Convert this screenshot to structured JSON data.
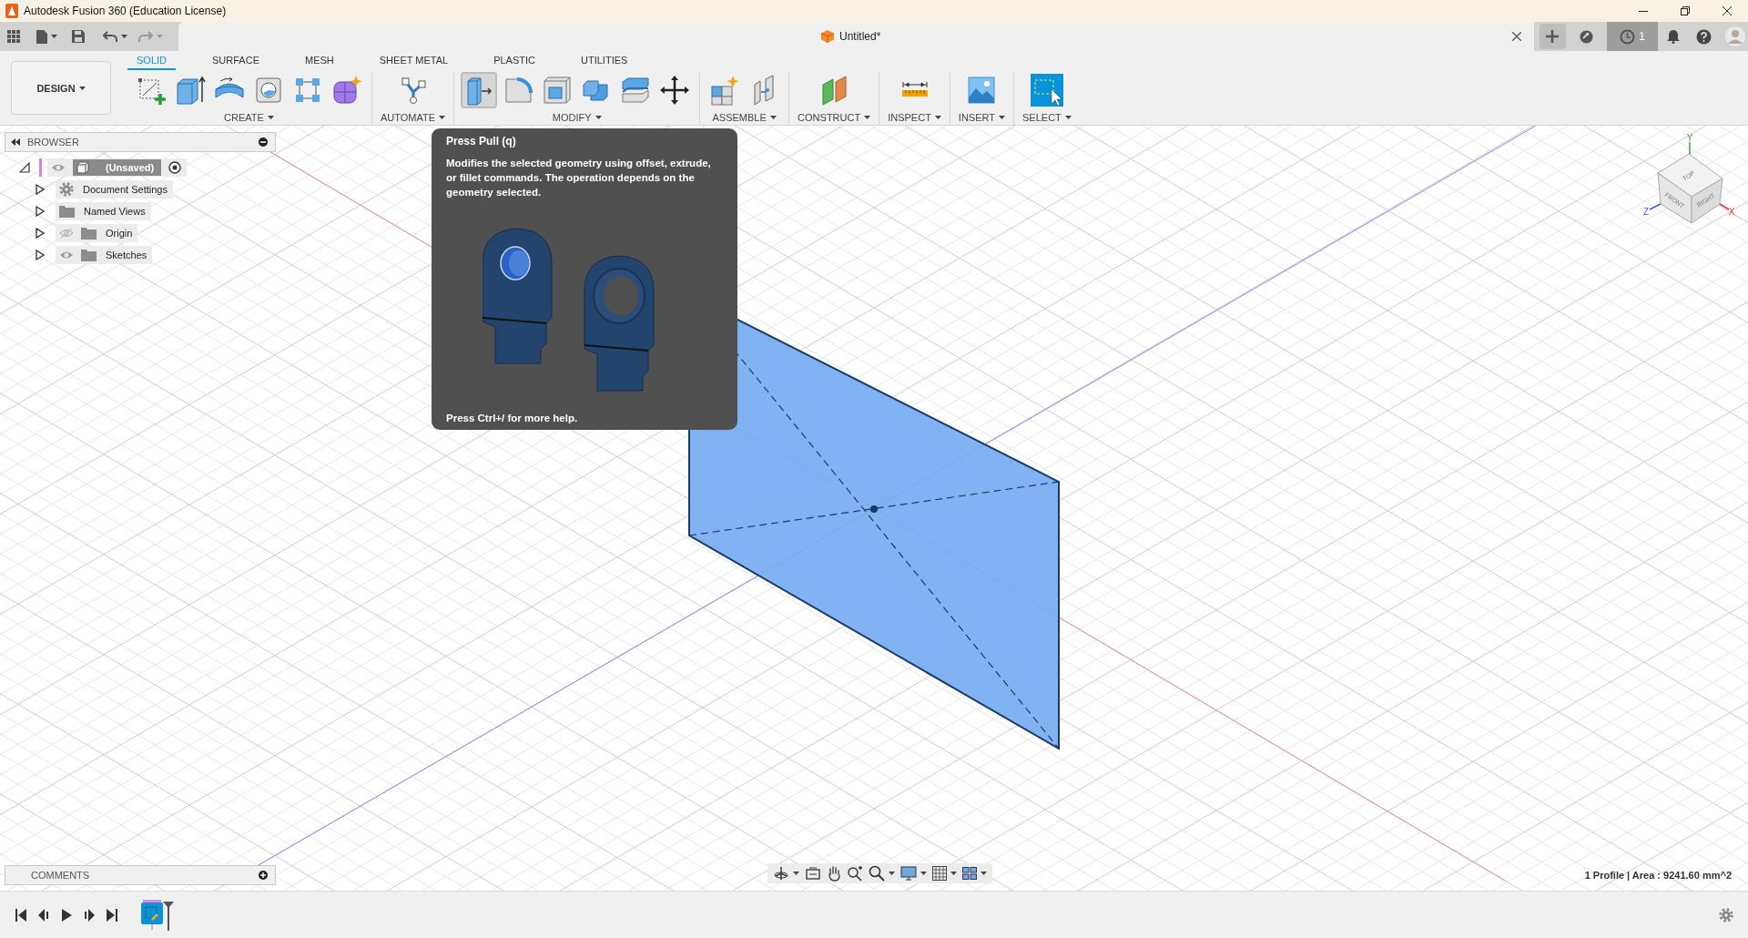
{
  "window": {
    "title": "Autodesk Fusion 360 (Education License)"
  },
  "document_tab": {
    "title": "Untitled*",
    "job_count": "1"
  },
  "workspace": {
    "label": "DESIGN"
  },
  "ribbon_tabs": [
    {
      "label": "SOLID",
      "selected": true
    },
    {
      "label": "SURFACE",
      "selected": false
    },
    {
      "label": "MESH",
      "selected": false
    },
    {
      "label": "SHEET METAL",
      "selected": false
    },
    {
      "label": "PLASTIC",
      "selected": false
    },
    {
      "label": "UTILITIES",
      "selected": false
    }
  ],
  "ribbon_groups": [
    {
      "label": "CREATE",
      "tools": [
        {
          "kind": "sketch",
          "hovered": false
        },
        {
          "kind": "extrude",
          "hovered": false
        },
        {
          "kind": "revolve",
          "hovered": false
        },
        {
          "kind": "hole",
          "hovered": false
        },
        {
          "kind": "pattern",
          "hovered": false
        },
        {
          "kind": "form",
          "hovered": false
        }
      ]
    },
    {
      "label": "AUTOMATE",
      "tools": [
        {
          "kind": "automate",
          "hovered": false
        }
      ]
    },
    {
      "label": "MODIFY",
      "tools": [
        {
          "kind": "press_pull",
          "hovered": true
        },
        {
          "kind": "fillet",
          "hovered": false
        },
        {
          "kind": "shell",
          "hovered": false
        },
        {
          "kind": "combine",
          "hovered": false
        },
        {
          "kind": "offset_face",
          "hovered": false
        },
        {
          "kind": "move",
          "hovered": false
        }
      ]
    },
    {
      "label": "ASSEMBLE",
      "tools": [
        {
          "kind": "new_component",
          "hovered": false
        },
        {
          "kind": "joint",
          "hovered": false
        }
      ]
    },
    {
      "label": "CONSTRUCT",
      "tools": [
        {
          "kind": "plane",
          "hovered": false
        }
      ]
    },
    {
      "label": "INSPECT",
      "tools": [
        {
          "kind": "measure",
          "hovered": false
        }
      ]
    },
    {
      "label": "INSERT",
      "tools": [
        {
          "kind": "insert_image",
          "hovered": false
        }
      ]
    },
    {
      "label": "SELECT",
      "tools": [
        {
          "kind": "select",
          "hovered": false
        }
      ]
    }
  ],
  "browser": {
    "title": "BROWSER",
    "tree": {
      "label": "(Unsaved)",
      "kind": "component",
      "visible": true,
      "expanded": true,
      "children": [
        {
          "label": "Document Settings",
          "kind": "settings",
          "expanded": false
        },
        {
          "label": "Named Views",
          "kind": "views",
          "expanded": false
        },
        {
          "label": "Origin",
          "kind": "folder",
          "visible": false,
          "expanded": false
        },
        {
          "label": "Sketches",
          "kind": "folder",
          "visible": true,
          "expanded": false
        }
      ]
    }
  },
  "tooltip": {
    "title": "Press Pull (q)",
    "description": "Modifies the selected geometry using offset, extrude, or fillet commands. The operation depends on the geometry selected.",
    "hint": "Press Ctrl+/ for more help."
  },
  "view_cube": {
    "faces": [
      "TOP",
      "FRONT",
      "RIGHT"
    ],
    "axes": [
      "Y",
      "Z",
      "X"
    ]
  },
  "comments": {
    "title": "COMMENTS"
  },
  "status": "1 Profile | Area : 9241.60 mm^2"
}
